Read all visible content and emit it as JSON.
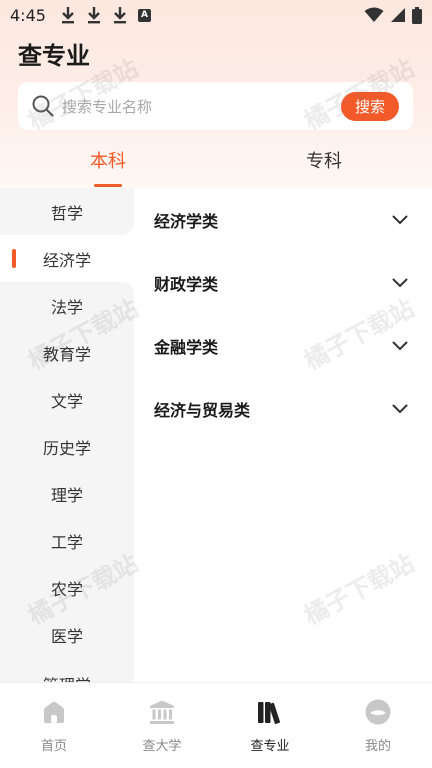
{
  "status_bar": {
    "time": "4:45",
    "left_icons": [
      "download-icon",
      "download-icon",
      "download-icon",
      "a-box-icon"
    ],
    "a_label": "A",
    "right_icons": [
      "wifi-icon",
      "signal-icon",
      "battery-icon"
    ]
  },
  "header": {
    "title": "查专业"
  },
  "search": {
    "placeholder": "搜索专业名称",
    "button_label": "搜索"
  },
  "tabs": [
    {
      "label": "本科",
      "active": true
    },
    {
      "label": "专科",
      "active": false
    }
  ],
  "sidebar": {
    "items": [
      {
        "label": "哲学"
      },
      {
        "label": "经济学",
        "active": true
      },
      {
        "label": "法学"
      },
      {
        "label": "教育学"
      },
      {
        "label": "文学"
      },
      {
        "label": "历史学"
      },
      {
        "label": "理学"
      },
      {
        "label": "工学"
      },
      {
        "label": "农学"
      },
      {
        "label": "医学"
      },
      {
        "label": "管理学"
      }
    ]
  },
  "categories": [
    {
      "label": "经济学类"
    },
    {
      "label": "财政学类"
    },
    {
      "label": "金融学类"
    },
    {
      "label": "经济与贸易类"
    }
  ],
  "bottom_nav": [
    {
      "label": "首页",
      "icon": "home-icon"
    },
    {
      "label": "查大学",
      "icon": "university-icon"
    },
    {
      "label": "查专业",
      "icon": "books-icon",
      "active": true
    },
    {
      "label": "我的",
      "icon": "profile-icon"
    }
  ],
  "watermark": "橘子下载站",
  "colors": {
    "accent": "#f25a2a",
    "header_bg": "#fde8df",
    "sidebar_bg": "#f5f5f5"
  }
}
